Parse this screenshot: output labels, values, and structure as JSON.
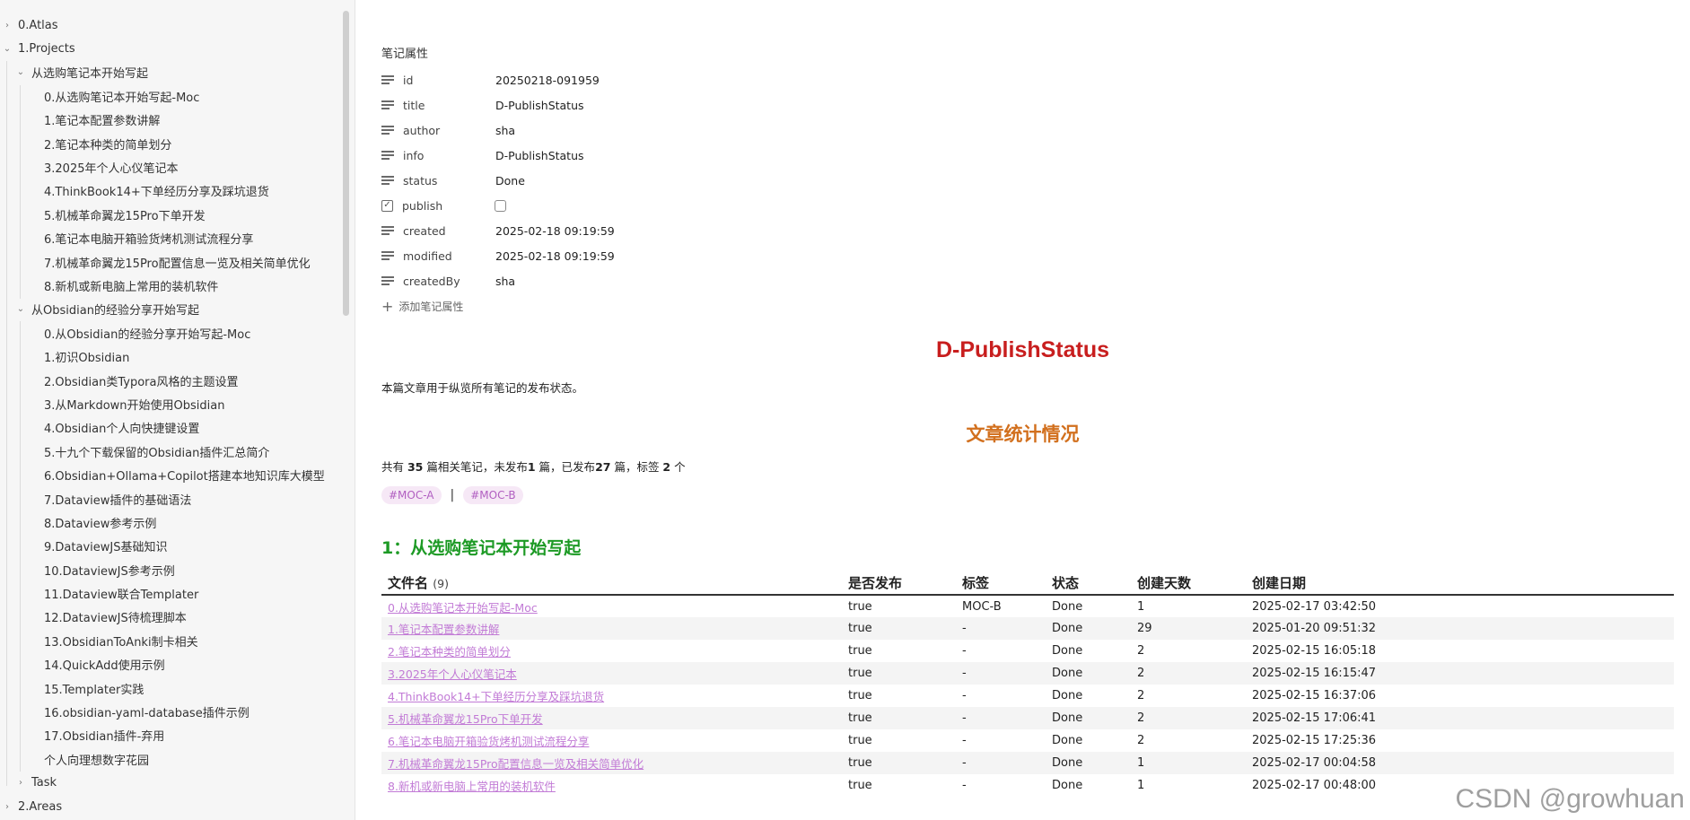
{
  "sidebar": {
    "items": [
      {
        "label": "0.Atlas",
        "level": 0,
        "chevron": "right"
      },
      {
        "label": "1.Projects",
        "level": 0,
        "chevron": "down"
      },
      {
        "label": "从选购笔记本开始写起",
        "level": 1,
        "chevron": "down"
      },
      {
        "label": "0.从选购笔记本开始写起-Moc",
        "level": 2
      },
      {
        "label": "1.笔记本配置参数讲解",
        "level": 2
      },
      {
        "label": "2.笔记本种类的简单划分",
        "level": 2
      },
      {
        "label": "3.2025年个人心仪笔记本",
        "level": 2
      },
      {
        "label": "4.ThinkBook14+下单经历分享及踩坑退货",
        "level": 2
      },
      {
        "label": "5.机械革命翼龙15Pro下单开发",
        "level": 2
      },
      {
        "label": "6.笔记本电脑开箱验货烤机测试流程分享",
        "level": 2
      },
      {
        "label": "7.机械革命翼龙15Pro配置信息一览及相关简单优化",
        "level": 2
      },
      {
        "label": "8.新机或新电脑上常用的装机软件",
        "level": 2
      },
      {
        "label": "从Obsidian的经验分享开始写起",
        "level": 1,
        "chevron": "down"
      },
      {
        "label": "0.从Obsidian的经验分享开始写起-Moc",
        "level": 2
      },
      {
        "label": "1.初识Obsidian",
        "level": 2
      },
      {
        "label": "2.Obsidian类Typora风格的主题设置",
        "level": 2
      },
      {
        "label": "3.从Markdown开始使用Obsidian",
        "level": 2
      },
      {
        "label": "4.Obsidian个人向快捷键设置",
        "level": 2
      },
      {
        "label": "5.十九个下载保留的Obsidian插件汇总简介",
        "level": 2
      },
      {
        "label": "6.Obsidian+Ollama+Copilot搭建本地知识库大模型",
        "level": 2
      },
      {
        "label": "7.Dataview插件的基础语法",
        "level": 2
      },
      {
        "label": "8.Dataview参考示例",
        "level": 2
      },
      {
        "label": "9.DataviewJS基础知识",
        "level": 2
      },
      {
        "label": "10.DataviewJS参考示例",
        "level": 2
      },
      {
        "label": "11.Dataview联合Templater",
        "level": 2
      },
      {
        "label": "12.DataviewJS待梳理脚本",
        "level": 2
      },
      {
        "label": "13.ObsidianToAnki制卡相关",
        "level": 2
      },
      {
        "label": "14.QuickAdd使用示例",
        "level": 2
      },
      {
        "label": "15.Templater实践",
        "level": 2
      },
      {
        "label": "16.obsidian-yaml-database插件示例",
        "level": 2
      },
      {
        "label": "17.Obsidian插件-弃用",
        "level": 2
      },
      {
        "label": "个人向理想数字花园",
        "level": 2
      },
      {
        "label": "Task",
        "level": 1,
        "chevron": "right"
      },
      {
        "label": "2.Areas",
        "level": 0,
        "chevron": "right"
      }
    ]
  },
  "properties": {
    "heading": "笔记属性",
    "rows": [
      {
        "key": "id",
        "value": "20250218-091959",
        "icon": "lines-icon"
      },
      {
        "key": "title",
        "value": "D-PublishStatus",
        "icon": "lines-icon"
      },
      {
        "key": "author",
        "value": "sha",
        "icon": "lines-icon"
      },
      {
        "key": "info",
        "value": "D-PublishStatus",
        "icon": "lines-icon"
      },
      {
        "key": "status",
        "value": "Done",
        "icon": "lines-icon"
      },
      {
        "key": "publish",
        "value": "",
        "icon": "checkbox-icon",
        "checkbox": true
      },
      {
        "key": "created",
        "value": "2025-02-18 09:19:59",
        "icon": "lines-icon"
      },
      {
        "key": "modified",
        "value": "2025-02-18 09:19:59",
        "icon": "lines-icon"
      },
      {
        "key": "createdBy",
        "value": "sha",
        "icon": "lines-icon"
      }
    ],
    "add_label": "添加笔记属性"
  },
  "document": {
    "title": "D-PublishStatus",
    "description": "本篇文章用于纵览所有笔记的发布状态。",
    "section_title": "文章统计情况",
    "stats": {
      "prefix": "共有 ",
      "total": "35",
      "mid1": " 篇相关笔记，未发布",
      "unpublished": "1",
      "mid2": " 篇，已发布",
      "published": "27",
      "mid3": " 篇，标签 ",
      "tag_count": "2",
      "suffix": " 个"
    },
    "tags": [
      "#MOC-A",
      "#MOC-B"
    ],
    "tag_separator": "|",
    "group_title": "1：从选购笔记本开始写起"
  },
  "table": {
    "headers": {
      "name": "文件名",
      "count": "(9)",
      "published": "是否发布",
      "tags": "标签",
      "status": "状态",
      "days": "创建天数",
      "date": "创建日期"
    },
    "rows": [
      {
        "name": "0.从选购笔记本开始写起-Moc",
        "published": "true",
        "tags": "MOC-B",
        "status": "Done",
        "days": "1",
        "date": "2025-02-17 03:42:50"
      },
      {
        "name": "1.笔记本配置参数讲解",
        "published": "true",
        "tags": "-",
        "status": "Done",
        "days": "29",
        "date": "2025-01-20 09:51:32"
      },
      {
        "name": "2.笔记本种类的简单划分",
        "published": "true",
        "tags": "-",
        "status": "Done",
        "days": "2",
        "date": "2025-02-15 16:05:18"
      },
      {
        "name": "3.2025年个人心仪笔记本",
        "published": "true",
        "tags": "-",
        "status": "Done",
        "days": "2",
        "date": "2025-02-15 16:15:47"
      },
      {
        "name": "4.ThinkBook14+下单经历分享及踩坑退货",
        "published": "true",
        "tags": "-",
        "status": "Done",
        "days": "2",
        "date": "2025-02-15 16:37:06"
      },
      {
        "name": "5.机械革命翼龙15Pro下单开发",
        "published": "true",
        "tags": "-",
        "status": "Done",
        "days": "2",
        "date": "2025-02-15 17:06:41"
      },
      {
        "name": "6.笔记本电脑开箱验货烤机测试流程分享",
        "published": "true",
        "tags": "-",
        "status": "Done",
        "days": "2",
        "date": "2025-02-15 17:25:36"
      },
      {
        "name": "7.机械革命翼龙15Pro配置信息一览及相关简单优化",
        "published": "true",
        "tags": "-",
        "status": "Done",
        "days": "1",
        "date": "2025-02-17 00:04:58"
      },
      {
        "name": "8.新机或新电脑上常用的装机软件",
        "published": "true",
        "tags": "-",
        "status": "Done",
        "days": "1",
        "date": "2025-02-17 00:48:00"
      }
    ]
  },
  "watermark": "CSDN @growhuan",
  "colors": {
    "title_red": "#c81e1e",
    "section_orange": "#d2701e",
    "group_green": "#1d9a25",
    "link_purple": "#c27bd6",
    "tag_bg": "#f6e8f6"
  }
}
